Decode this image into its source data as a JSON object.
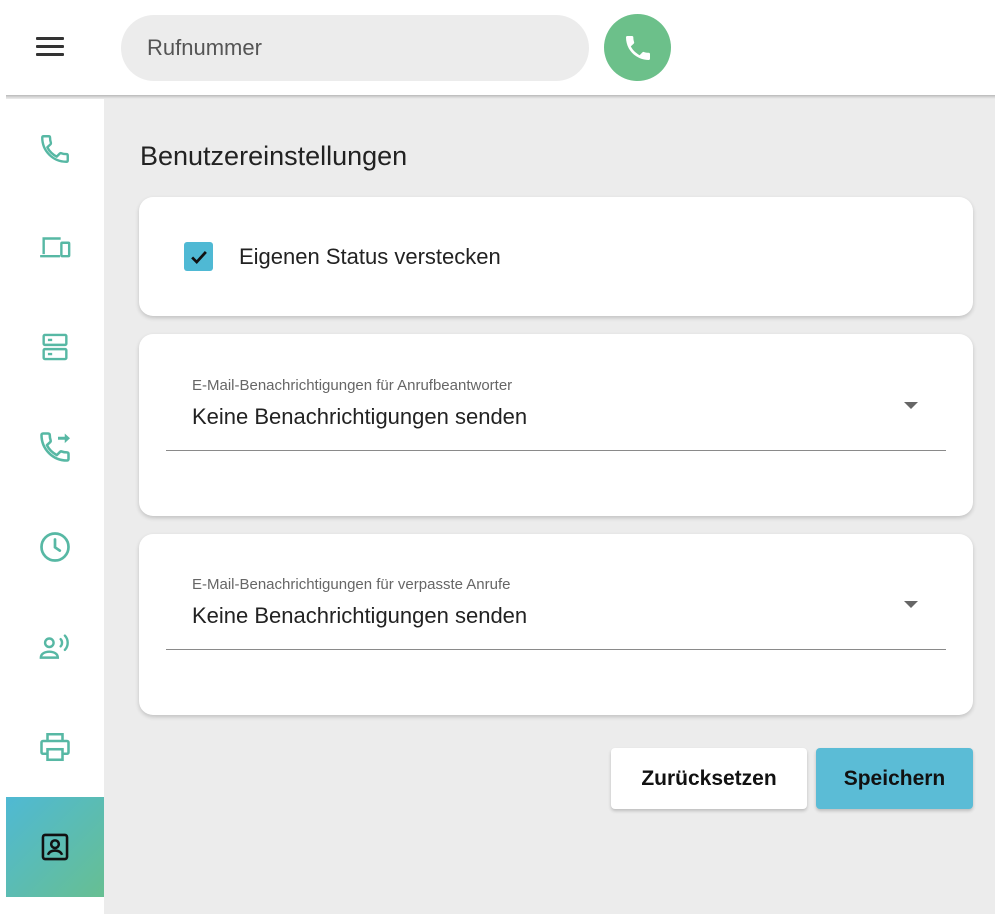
{
  "search": {
    "placeholder": "Rufnummer"
  },
  "colors": {
    "accent": "#4fb9d4",
    "call_green": "#6cc08a",
    "icon_teal": "#57b8a4"
  },
  "icons": {
    "menu": "menu-icon",
    "call": "phone-icon",
    "sidebar": [
      "phone-icon",
      "devices-icon",
      "server-icon",
      "call-forward-icon",
      "clock-icon",
      "voice-user-icon",
      "printer-icon",
      "contact-card-icon"
    ]
  },
  "page": {
    "title": "Benutzereinstellungen"
  },
  "status_card": {
    "checkbox_label": "Eigenen Status verstecken",
    "checked": true
  },
  "voicemail_select": {
    "label": "E-Mail-Benachrichtigungen für Anrufbeantworter",
    "value": "Keine Benachrichtigungen senden"
  },
  "missed_select": {
    "label": "E-Mail-Benachrichtigungen für verpasste Anrufe",
    "value": "Keine Benachrichtigungen senden"
  },
  "actions": {
    "reset_label": "Zurücksetzen",
    "save_label": "Speichern"
  }
}
